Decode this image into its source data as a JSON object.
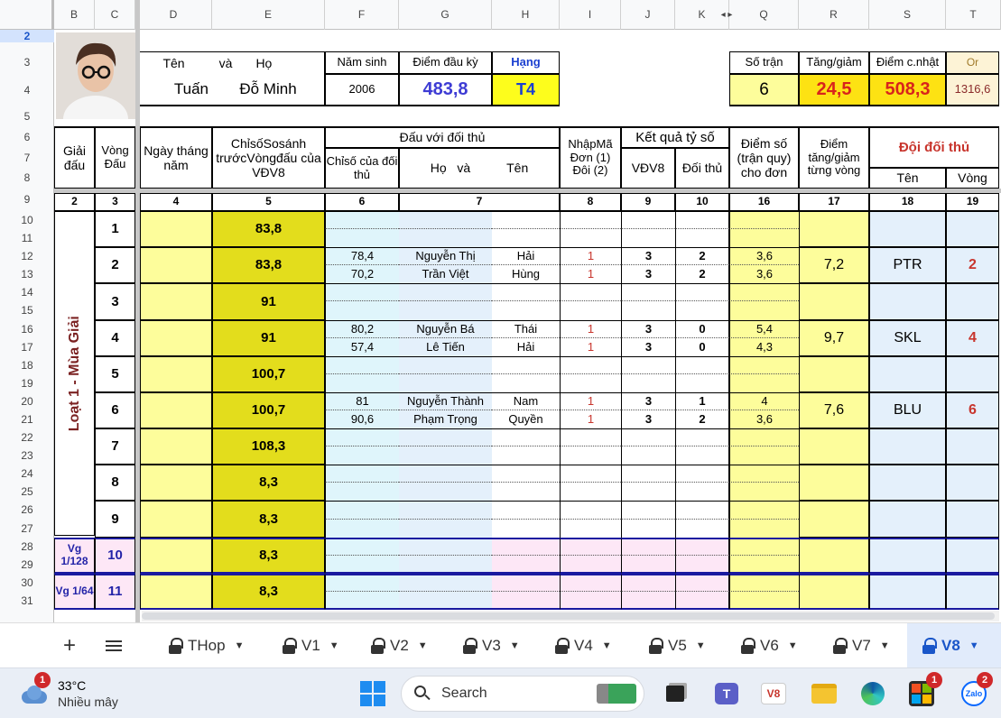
{
  "columns": [
    "B",
    "C",
    "D",
    "E",
    "F",
    "G",
    "H",
    "I",
    "J",
    "K",
    "Q",
    "R",
    "S",
    "T"
  ],
  "rows": [
    "2",
    "3",
    "4",
    "5",
    "6",
    "7",
    "8",
    "9",
    "10",
    "11",
    "12",
    "13",
    "14",
    "15",
    "16",
    "17",
    "18",
    "19",
    "20",
    "21",
    "22",
    "23",
    "24",
    "25",
    "26",
    "27",
    "28",
    "29",
    "30",
    "31"
  ],
  "header": {
    "name_label_ten": "Tên",
    "name_label_va": "và",
    "name_label_ho": "Họ",
    "birth_label": "Năm sinh",
    "start_score_label": "Điểm đầu kỳ",
    "rank_label": "Hạng",
    "first_name": "Tuấn",
    "last_name": "Đỗ Minh",
    "birth_year": "2006",
    "start_score": "483,8",
    "rank": "T4",
    "matches_label": "Số trận",
    "change_label": "Tăng/giảm",
    "updated_label": "Điểm c.nhật",
    "or_label": "Or",
    "matches": "6",
    "change": "24,5",
    "updated": "508,3",
    "or_value": "1316,6"
  },
  "table_head": {
    "tournament": "Giải đấu",
    "round": "Vòng Đấu",
    "date": "Ngày tháng năm",
    "index_compare": "ChỉsốSosánh trướcVòngđấu của VĐV8",
    "vs_opponent": "Đấu với đối thủ",
    "opp_index": "Chỉsố của đối thủ",
    "opp_name_ho": "Họ",
    "opp_name_va": "và",
    "opp_name_ten": "Tên",
    "entry_code": "NhậpMã Đơn (1) Đôi (2)",
    "result": "Kết quả tỷ số",
    "result_vdv": "VĐV8",
    "result_opp": "Đối thủ",
    "score": "Điểm số (trận quy) cho đơn",
    "score_change": "Điểm tăng/giảm từng vòng",
    "opp_team": "Đội đối thủ",
    "opp_team_name": "Tên",
    "opp_team_round": "Vòng"
  },
  "col_numbers": [
    "2",
    "3",
    "4",
    "5",
    "6",
    "7",
    "8",
    "9",
    "10",
    "16",
    "17",
    "18",
    "19"
  ],
  "season_label": "Loạt 1 - Mùa Giải",
  "rounds": [
    {
      "round": "1",
      "index": "83,8",
      "opponents": [],
      "change": "",
      "team": "",
      "team_round": ""
    },
    {
      "round": "2",
      "index": "83,8",
      "opponents": [
        {
          "idx": "78,4",
          "ho": "Nguyễn Thị",
          "ten": "Hải",
          "code": "1",
          "a": "3",
          "b": "2",
          "score": "3,6"
        },
        {
          "idx": "70,2",
          "ho": "Trần Việt",
          "ten": "Hùng",
          "code": "1",
          "a": "3",
          "b": "2",
          "score": "3,6"
        }
      ],
      "change": "7,2",
      "team": "PTR",
      "team_round": "2"
    },
    {
      "round": "3",
      "index": "91",
      "opponents": [],
      "change": "",
      "team": "",
      "team_round": ""
    },
    {
      "round": "4",
      "index": "91",
      "opponents": [
        {
          "idx": "80,2",
          "ho": "Nguyễn Bá",
          "ten": "Thái",
          "code": "1",
          "a": "3",
          "b": "0",
          "score": "5,4"
        },
        {
          "idx": "57,4",
          "ho": "Lê Tiến",
          "ten": "Hải",
          "code": "1",
          "a": "3",
          "b": "0",
          "score": "4,3"
        }
      ],
      "change": "9,7",
      "team": "SKL",
      "team_round": "4"
    },
    {
      "round": "5",
      "index": "100,7",
      "opponents": [],
      "change": "",
      "team": "",
      "team_round": ""
    },
    {
      "round": "6",
      "index": "100,7",
      "opponents": [
        {
          "idx": "81",
          "ho": "Nguyễn Thành",
          "ten": "Nam",
          "code": "1",
          "a": "3",
          "b": "1",
          "score": "4"
        },
        {
          "idx": "90,6",
          "ho": "Phạm Trọng",
          "ten": "Quyền",
          "code": "1",
          "a": "3",
          "b": "2",
          "score": "3,6"
        }
      ],
      "change": "7,6",
      "team": "BLU",
      "team_round": "6"
    },
    {
      "round": "7",
      "index": "108,3",
      "opponents": [],
      "change": "",
      "team": "",
      "team_round": ""
    },
    {
      "round": "8",
      "index": "8,3",
      "opponents": [],
      "change": "",
      "team": "",
      "team_round": ""
    },
    {
      "round": "9",
      "index": "8,3",
      "opponents": [],
      "change": "",
      "team": "",
      "team_round": ""
    },
    {
      "round": "10",
      "index": "8,3",
      "opponents": [],
      "change": "",
      "team": "",
      "team_round": "",
      "vg": "Vg 1/128"
    },
    {
      "round": "11",
      "index": "8,3",
      "opponents": [],
      "change": "",
      "team": "",
      "team_round": "",
      "vg": "Vg 1/64"
    }
  ],
  "sheet_tabs": [
    "THop",
    "V1",
    "V2",
    "V3",
    "V4",
    "V5",
    "V6",
    "V7",
    "V8"
  ],
  "active_tab": "V8",
  "taskbar": {
    "weather_temp": "33°C",
    "weather_desc": "Nhiều mây",
    "weather_badge": "1",
    "search_label": "Search",
    "store_badge": "1",
    "zalo_badge": "2",
    "zalo_label": "Zalo",
    "app_v8": "V8"
  },
  "colors": {
    "accent": "#1a56c9",
    "yellow": "#fdfd9b",
    "dark_yellow": "#e3dd1c",
    "red": "#c8352d",
    "rank_blue": "#3b3bd6"
  }
}
